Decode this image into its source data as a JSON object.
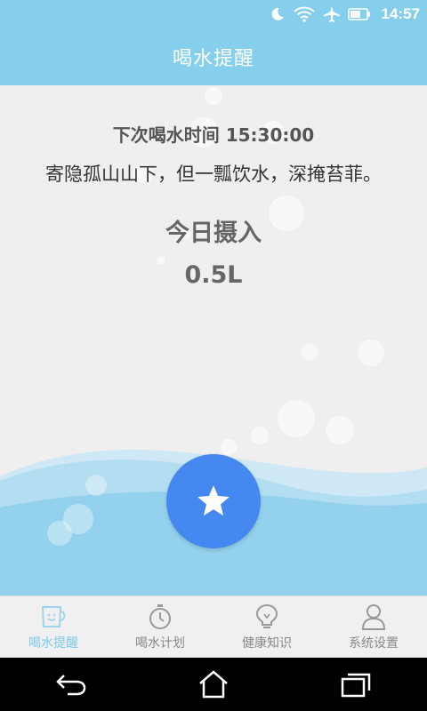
{
  "status_bar": {
    "time": "14:57",
    "icons": [
      "moon-icon",
      "wifi-icon",
      "airplane-icon",
      "battery-icon"
    ]
  },
  "app_bar": {
    "title": "喝水提醒"
  },
  "main": {
    "next_time_label": "下次喝水时间 15:30:00",
    "poem": "寄隐孤山山下，但一瓢饮水，深掩苔菲。",
    "intake_label": "今日摄入",
    "intake_value": "0.5L",
    "fab_icon": "star-icon"
  },
  "tabs": [
    {
      "label": "喝水提醒",
      "icon": "cup-icon",
      "active": true
    },
    {
      "label": "喝水计划",
      "icon": "stopwatch-icon",
      "active": false
    },
    {
      "label": "健康知识",
      "icon": "lightbulb-icon",
      "active": false
    },
    {
      "label": "系统设置",
      "icon": "person-icon",
      "active": false
    }
  ],
  "nav": [
    "back-icon",
    "home-icon",
    "recents-icon"
  ],
  "colors": {
    "primary": "#86cfec",
    "fab": "#4588f0",
    "active_tab": "#7cc8e8",
    "inactive_tab": "#888888",
    "water": "#93d1ec"
  }
}
